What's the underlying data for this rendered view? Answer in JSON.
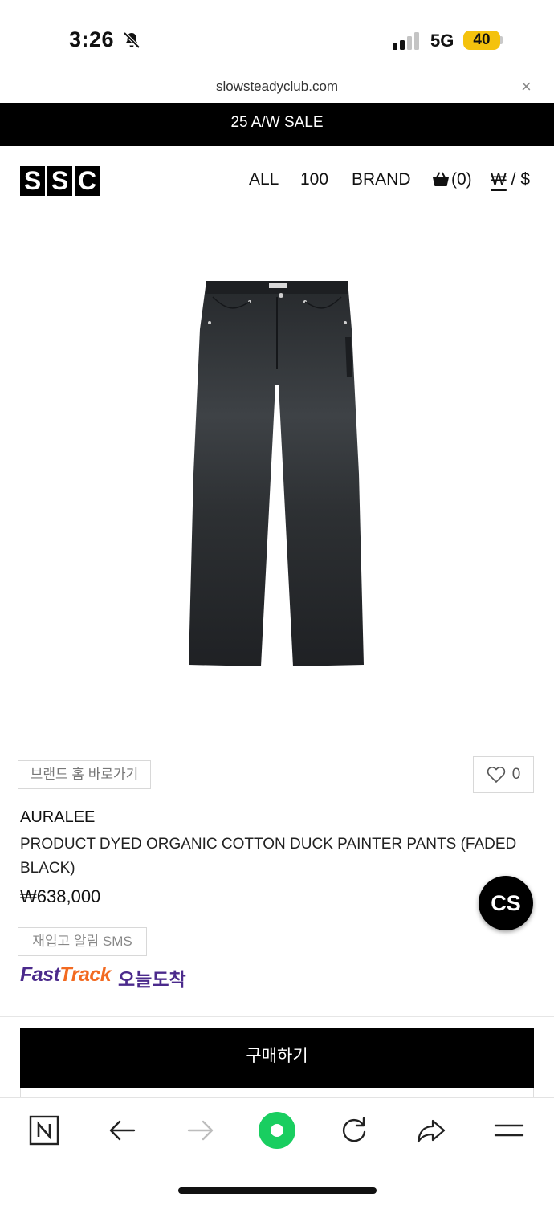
{
  "status": {
    "time": "3:26",
    "network": "5G",
    "battery": "40"
  },
  "browser": {
    "url": "slowsteadyclub.com",
    "close_label": "×"
  },
  "banner": {
    "text": "25 A/W SALE"
  },
  "header": {
    "logo_letters": [
      "S",
      "S",
      "C"
    ],
    "nav": {
      "all": "ALL",
      "hundred": "100",
      "brand": "BRAND"
    },
    "cart_count": "(0)",
    "currency_won": "₩",
    "currency_sep": " / ",
    "currency_usd": "$"
  },
  "product": {
    "brand_home_label": "브랜드 홈 바로가기",
    "like_count": "0",
    "brand": "AURALEE",
    "name": "PRODUCT DYED ORGANIC COTTON DUCK PAINTER PANTS (FADED BLACK)",
    "price": "₩638,000",
    "restock_label": "재입고 알림 SMS",
    "fasttrack_fast": "Fast",
    "fasttrack_track": "Track",
    "fasttrack_today": "오늘도착",
    "buy_label": "구매하기"
  },
  "cs_button": {
    "label": "CS"
  },
  "toolbar": {
    "icons": [
      "naver-icon",
      "back-arrow-icon",
      "forward-arrow-icon",
      "green-dot-icon",
      "reload-icon",
      "share-icon",
      "menu-icon"
    ]
  },
  "colors": {
    "accent_green": "#19ce60",
    "fasttrack_purple": "#4b2a8c",
    "fasttrack_orange": "#f26a21",
    "battery_yellow": "#f4c20d"
  }
}
